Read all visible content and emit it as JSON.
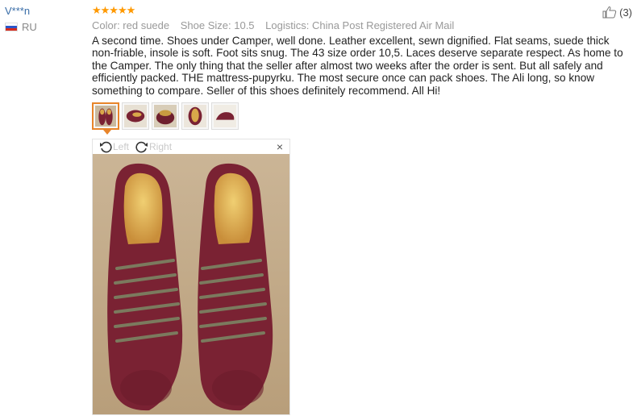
{
  "reviewer": {
    "name": "V***n",
    "country": "RU"
  },
  "review": {
    "stars": "★★★★★",
    "rating": 5,
    "meta": {
      "color": "Color: red suede",
      "size": "Shoe Size: 10.5",
      "logistics": "Logistics: China Post Registered Air Mail"
    },
    "likes": "(3)",
    "text": "A second time. Shoes under Camper, well done. Leather excellent, sewn dignified. Flat seams, suede thick non-friable, insole is soft. Foot sits snug. The 43 size order 10,5. Laces deserve separate respect. As home to the Camper. The only thing that the seller after almost two weeks after the order is sent. But all safely and efficiently packed. THE mattress-pupyrku. The most secure once can pack shoes. The Ali long, so know something to compare. Seller of this shoes definitely recommend. All Hi!"
  },
  "viewer": {
    "rotate_left": "Left",
    "rotate_right": "Right",
    "close": "×"
  },
  "colors": {
    "accent": "#e8852a",
    "star": "#ff9900",
    "link": "#3a6ea8",
    "shoe": "#7a2233"
  }
}
